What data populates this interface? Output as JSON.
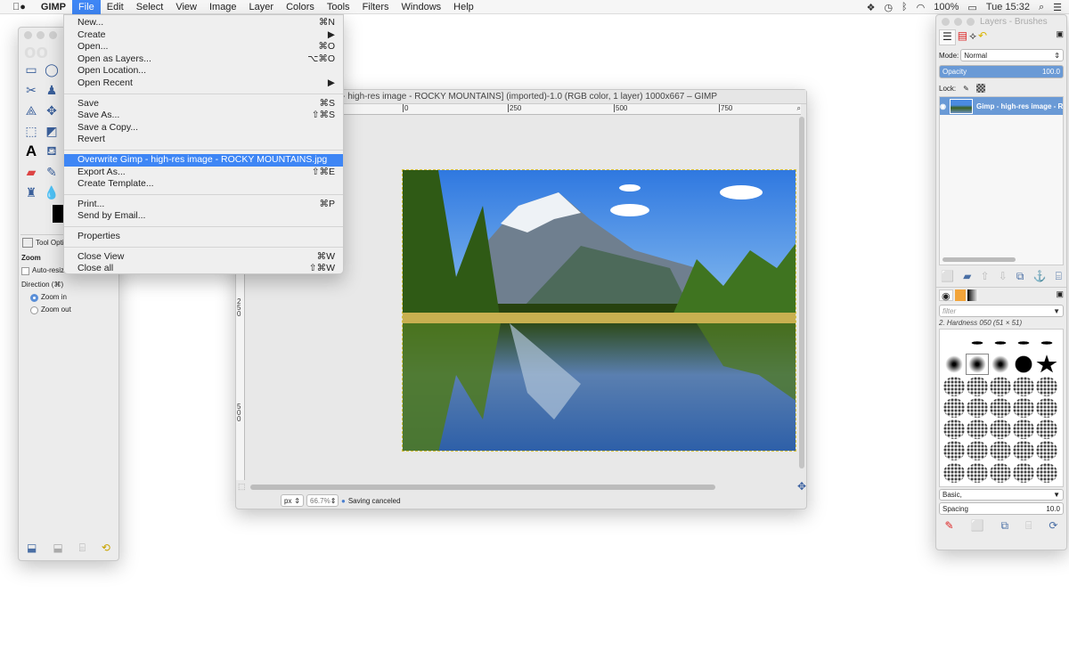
{
  "menubar": {
    "apple": "",
    "items": [
      "GIMP",
      "File",
      "Edit",
      "Select",
      "View",
      "Image",
      "Layer",
      "Colors",
      "Tools",
      "Filters",
      "Windows",
      "Help"
    ],
    "active": "File",
    "battery": "100%",
    "clock": "Tue 15:32"
  },
  "file_menu": [
    [
      {
        "label": "New...",
        "shortcut": "⌘N"
      },
      {
        "label": "Create",
        "shortcut": "▶"
      },
      {
        "label": "Open...",
        "shortcut": "⌘O"
      },
      {
        "label": "Open as Layers...",
        "shortcut": "⌥⌘O"
      },
      {
        "label": "Open Location...",
        "shortcut": ""
      },
      {
        "label": "Open Recent",
        "shortcut": "▶"
      }
    ],
    [
      {
        "label": "Save",
        "shortcut": "⌘S"
      },
      {
        "label": "Save As...",
        "shortcut": "⇧⌘S"
      },
      {
        "label": "Save a Copy...",
        "shortcut": ""
      },
      {
        "label": "Revert",
        "shortcut": ""
      }
    ],
    [
      {
        "label": "Overwrite Gimp - high-res image - ROCKY MOUNTAINS.jpg",
        "shortcut": "",
        "highlighted": true
      },
      {
        "label": "Export As...",
        "shortcut": "⇧⌘E"
      },
      {
        "label": "Create Template...",
        "shortcut": ""
      }
    ],
    [
      {
        "label": "Print...",
        "shortcut": "⌘P"
      },
      {
        "label": "Send by Email...",
        "shortcut": ""
      }
    ],
    [
      {
        "label": "Properties",
        "shortcut": ""
      }
    ],
    [
      {
        "label": "Close View",
        "shortcut": "⌘W"
      },
      {
        "label": "Close all",
        "shortcut": "⇧⌘W"
      }
    ]
  ],
  "toolbox": {
    "tool_options_label": "Tool Options",
    "section": "Zoom",
    "auto_resize": "Auto-resize window",
    "direction_label": "Direction  (⌘)",
    "zoom_in": "Zoom in",
    "zoom_out": "Zoom out",
    "selected_direction": "Zoom in"
  },
  "image_window": {
    "title": "[Gimp - high-res image - ROCKY MOUNTAINS] (imported)-1.0 (RGB color, 1 layer) 1000x667 – GIMP",
    "ruler_h": [
      "0",
      "250",
      "500",
      "750"
    ],
    "ruler_v": [
      "0",
      "250",
      "500"
    ],
    "unit": "px",
    "zoom": "66.7%",
    "status": "Saving canceled"
  },
  "dock": {
    "title": "Layers - Brushes",
    "mode_label": "Mode:",
    "mode": "Normal",
    "opacity_label": "Opacity",
    "opacity": "100.0",
    "lock_label": "Lock:",
    "layer_name": "Gimp - high-res image - ROCKY MOUNTAINS.jpg",
    "brush_filter_placeholder": "filter",
    "brush_name": "2. Hardness 050 (51 × 51)",
    "brush_tag": "Basic,",
    "spacing_label": "Spacing",
    "spacing": "10.0"
  },
  "colors": {
    "accent": "#3e86f5",
    "layer_selected": "#6a9ad6"
  }
}
